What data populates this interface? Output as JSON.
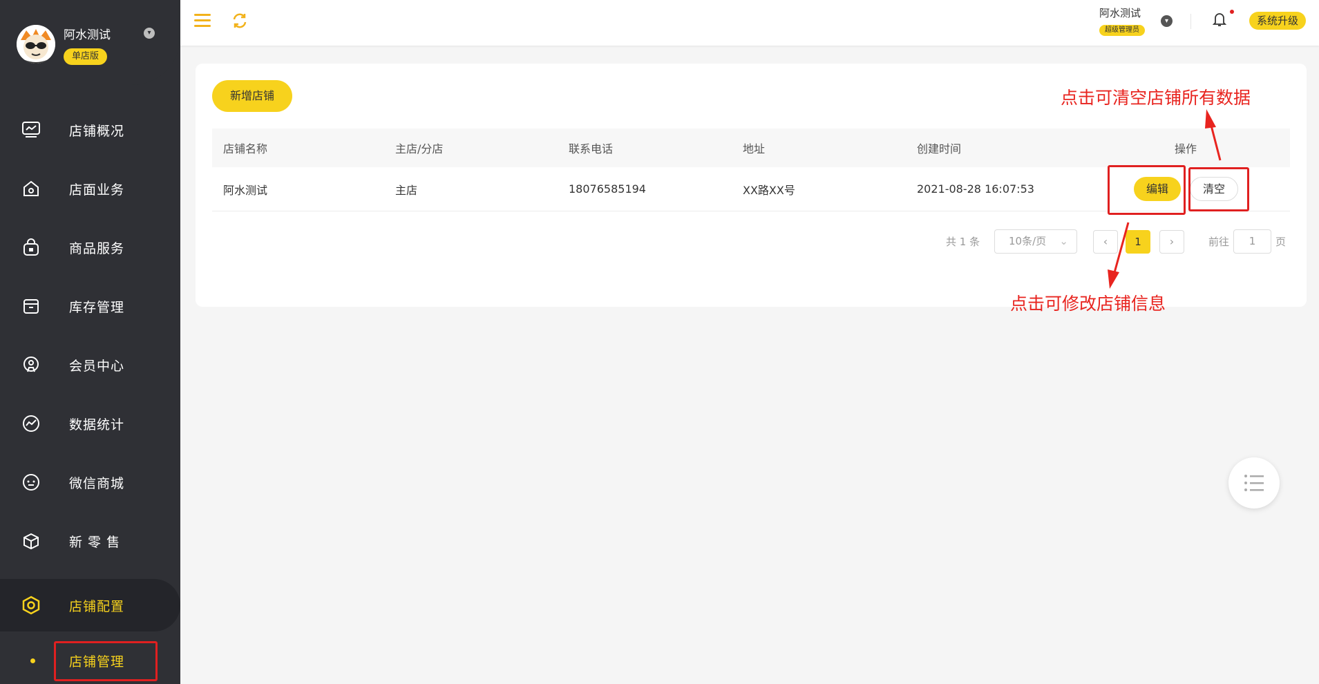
{
  "brand": {
    "name": "阿水测试",
    "badge": "单店版"
  },
  "sidebar": {
    "items": [
      {
        "label": "店铺概况",
        "icon": "monitor-chart-icon"
      },
      {
        "label": "店面业务",
        "icon": "home-icon"
      },
      {
        "label": "商品服务",
        "icon": "bag-icon"
      },
      {
        "label": "库存管理",
        "icon": "archive-icon"
      },
      {
        "label": "会员中心",
        "icon": "member-icon"
      },
      {
        "label": "数据统计",
        "icon": "trend-chart-icon"
      },
      {
        "label": "微信商城",
        "icon": "chat-face-icon"
      },
      {
        "label": "新 零 售",
        "icon": "box-icon"
      },
      {
        "label": "店铺配置",
        "icon": "settings-hex-icon"
      }
    ],
    "sub_item": "店铺管理"
  },
  "header": {
    "user_name": "阿水测试",
    "user_role": "超级管理员",
    "upgrade_label": "系统升级"
  },
  "main": {
    "add_button": "新增店铺",
    "table": {
      "headers": [
        "店铺名称",
        "主店/分店",
        "联系电话",
        "地址",
        "创建时间",
        "操作"
      ],
      "rows": [
        {
          "name": "阿水测试",
          "type": "主店",
          "phone": "18076585194",
          "address": "XX路XX号",
          "created": "2021-08-28 16:07:53"
        }
      ],
      "edit_label": "编辑",
      "clear_label": "清空"
    },
    "pagination": {
      "total": "共 1 条",
      "page_size": "10条/页",
      "current": "1",
      "goto_label": "前往",
      "goto_value": "1",
      "page_label": "页"
    }
  },
  "annotations": {
    "clear_note": "点击可清空店铺所有数据",
    "edit_note": "点击可修改店铺信息"
  },
  "colors": {
    "accent": "#f7d21d",
    "sidebar": "#2f3035",
    "annotation": "#e8241f"
  }
}
